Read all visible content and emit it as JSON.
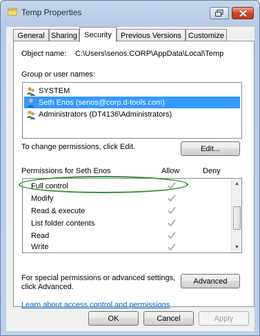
{
  "window": {
    "title": "Temp Properties"
  },
  "tabs": [
    {
      "label": "General"
    },
    {
      "label": "Sharing"
    },
    {
      "label": "Security",
      "active": true
    },
    {
      "label": "Previous Versions"
    },
    {
      "label": "Customize"
    }
  ],
  "security": {
    "object_name_label": "Object name:",
    "object_name_value": "C:\\Users\\senos.CORP\\AppData\\Local\\Temp",
    "group_label": "Group or user names:",
    "users": [
      {
        "name": "SYSTEM",
        "icon": "group-users-icon"
      },
      {
        "name": "Seth Enos (senos@corp.d-tools.com)",
        "icon": "user-icon",
        "selected": true
      },
      {
        "name": "Administrators (DT4136\\Administrators)",
        "icon": "group-users-icon"
      }
    ],
    "edit_hint": "To change permissions, click Edit.",
    "edit_button": "Edit...",
    "permissions_label": "Permissions for Seth Enos",
    "allow_header": "Allow",
    "deny_header": "Deny",
    "permissions": [
      {
        "name": "Full control",
        "allow": true,
        "deny": false
      },
      {
        "name": "Modify",
        "allow": true,
        "deny": false
      },
      {
        "name": "Read & execute",
        "allow": true,
        "deny": false
      },
      {
        "name": "List folder contents",
        "allow": true,
        "deny": false
      },
      {
        "name": "Read",
        "allow": true,
        "deny": false
      },
      {
        "name": "Write",
        "allow": true,
        "deny": false
      }
    ],
    "advanced_hint_line1": "For special permissions or advanced settings,",
    "advanced_hint_line2": "click Advanced.",
    "advanced_button": "Advanced",
    "learn_link": "Learn about access control and permissions"
  },
  "footer": {
    "ok": "OK",
    "cancel": "Cancel",
    "apply": "Apply"
  },
  "colors": {
    "selection": "#3399ff",
    "highlight_ellipse": "#2e8b2e",
    "link": "#0066cc"
  }
}
